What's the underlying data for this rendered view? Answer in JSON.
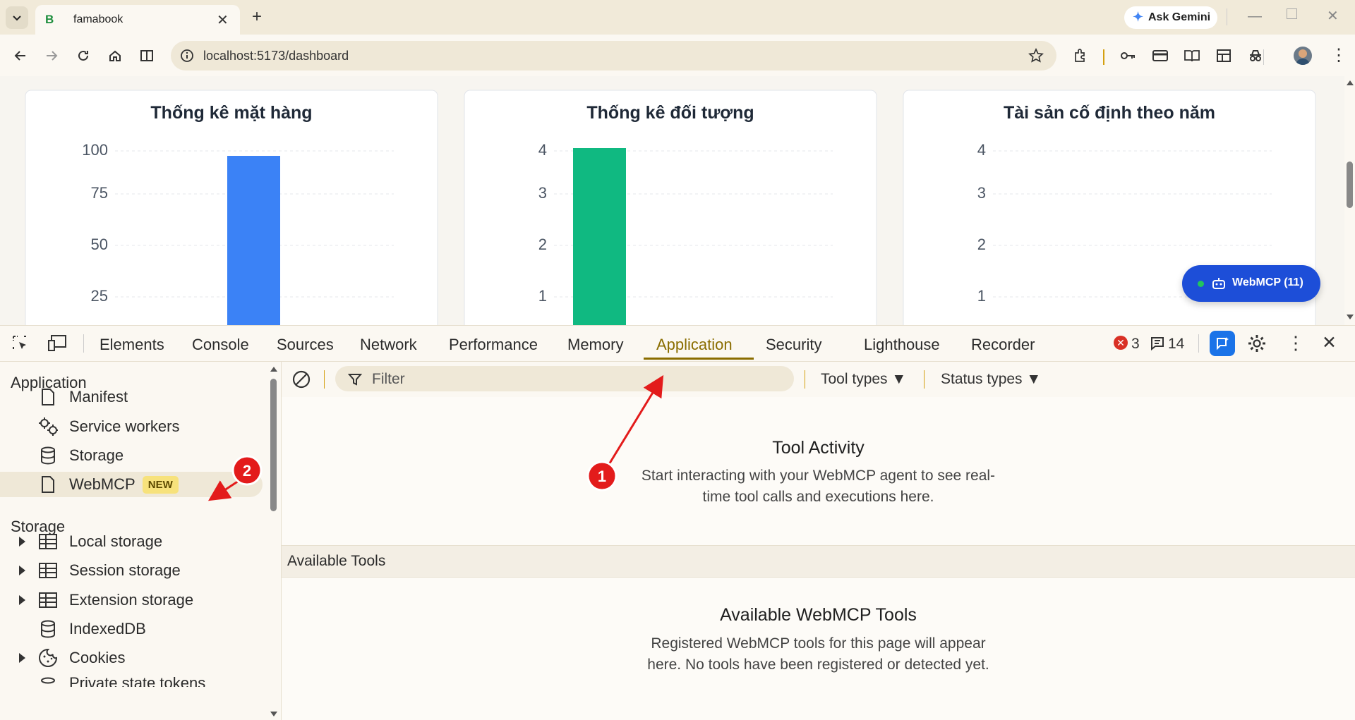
{
  "browser": {
    "tab_title": "famabook",
    "tab_favicon": "B",
    "new_tab": "+",
    "url": "localhost:5173/dashboard",
    "ask_gemini": "Ask Gemini"
  },
  "page": {
    "cards": [
      {
        "title": "Thống kê mặt hàng",
        "ticks": [
          "100",
          "75",
          "50",
          "25"
        ]
      },
      {
        "title": "Thống kê đối tượng",
        "ticks": [
          "4",
          "3",
          "2",
          "1"
        ]
      },
      {
        "title": "Tài sản cố định theo năm",
        "ticks": [
          "4",
          "3",
          "2",
          "1"
        ]
      }
    ],
    "bar_colors": {
      "blue": "#3b82f6",
      "green": "#10b981"
    },
    "webmcp_button": "WebMCP (11)"
  },
  "devtools": {
    "tabs": [
      "Elements",
      "Console",
      "Sources",
      "Network",
      "Performance",
      "Memory",
      "Application",
      "Security",
      "Lighthouse",
      "Recorder"
    ],
    "active_tab": "Application",
    "errors_count": "3",
    "messages_count": "14",
    "sidebar": {
      "application_heading": "Application",
      "application_items": [
        "Manifest",
        "Service workers",
        "Storage",
        "WebMCP"
      ],
      "new_badge": "NEW",
      "storage_heading": "Storage",
      "storage_items": [
        "Local storage",
        "Session storage",
        "Extension storage",
        "IndexedDB",
        "Cookies",
        "Private state tokens"
      ]
    },
    "filter_placeholder": "Filter",
    "tool_types": "Tool types",
    "status_types": "Status types",
    "tool_activity": {
      "title": "Tool Activity",
      "desc": "Start interacting with your WebMCP agent to see real-time tool calls and executions here."
    },
    "available_tools_header": "Available Tools",
    "available": {
      "title": "Available WebMCP Tools",
      "desc": "Registered WebMCP tools for this page will appear here. No tools have been registered or detected yet."
    }
  },
  "annotations": {
    "one": "1",
    "two": "2"
  }
}
